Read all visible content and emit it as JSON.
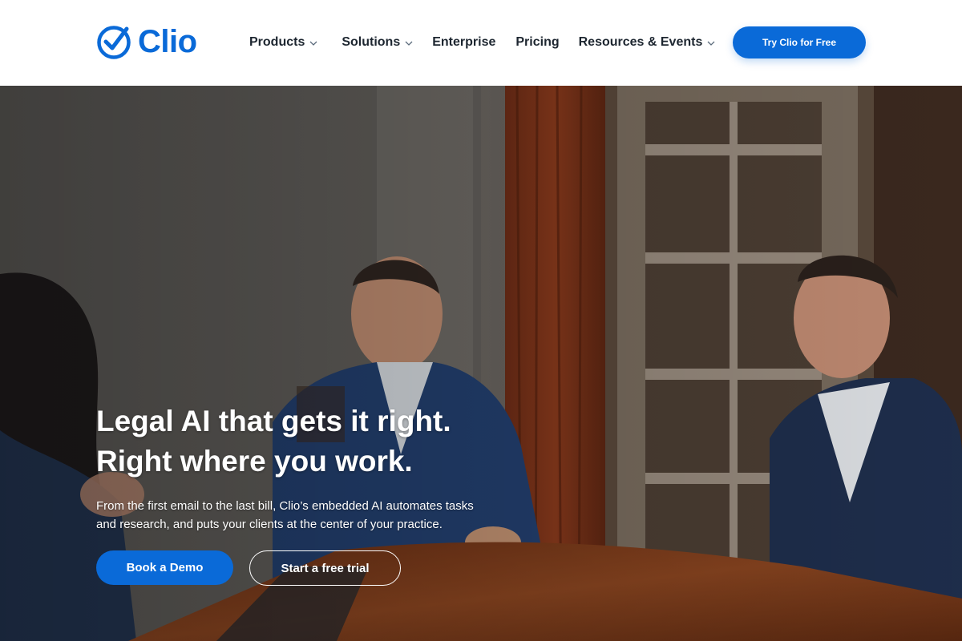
{
  "brand": {
    "name": "Clio",
    "logo_icon": "checkmark-circle-icon",
    "color": "#0a6ad8"
  },
  "nav": {
    "items": [
      {
        "label": "Products",
        "has_dropdown": true
      },
      {
        "label": "Solutions",
        "has_dropdown": true
      },
      {
        "label": "Enterprise",
        "has_dropdown": false
      },
      {
        "label": "Pricing",
        "has_dropdown": false
      },
      {
        "label": "Resources & Events",
        "has_dropdown": true
      }
    ],
    "cta_label": "Try Clio for Free"
  },
  "hero": {
    "headline_line1": "Legal AI that gets it right.",
    "headline_line2": "Right where you work.",
    "subtext": "From the first email to the last bill, Clio’s embedded AI automates tasks and research, and puts your clients at the center of your practice.",
    "primary_button": "Book a Demo",
    "secondary_button": "Start a free trial",
    "background_image": "three-people-meeting-at-table-photo"
  },
  "colors": {
    "accent": "#0a6ad8",
    "text_dark": "#1d2630",
    "white": "#ffffff"
  }
}
